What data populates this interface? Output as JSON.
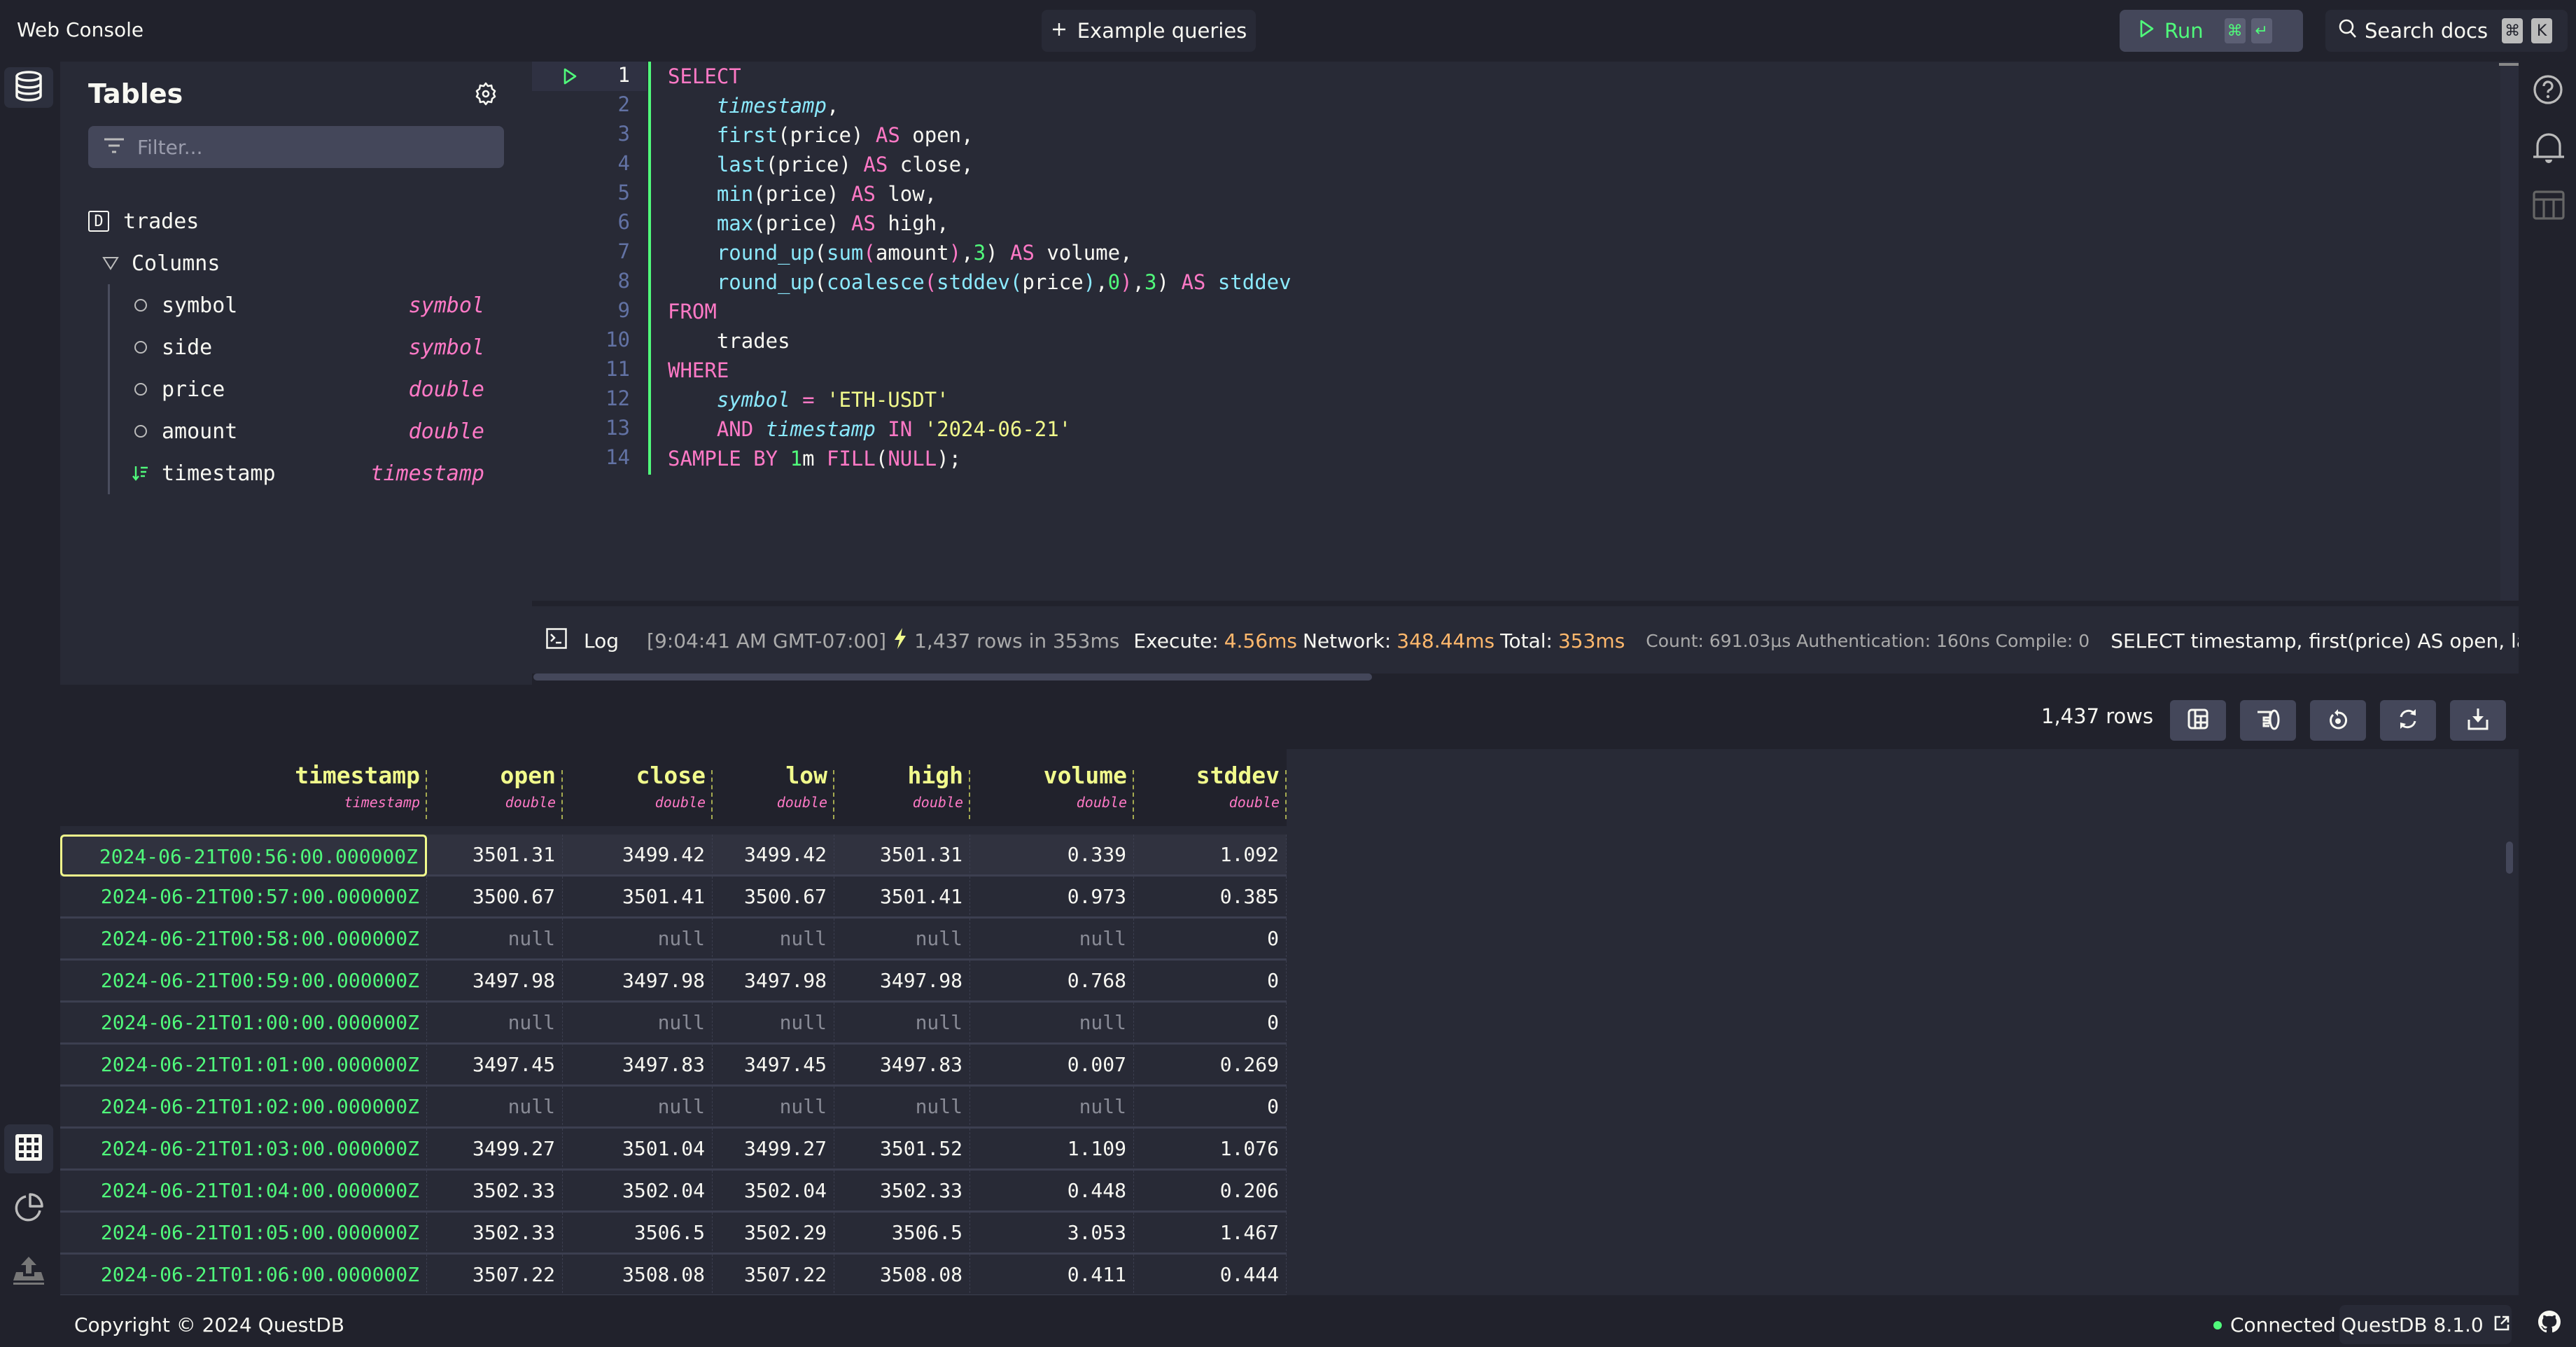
{
  "app": {
    "title": "Web Console"
  },
  "toolbar": {
    "example_queries_label": "Example queries",
    "run_label": "Run",
    "run_shortcut": [
      "⌘",
      "↵"
    ],
    "search_docs_label": "Search docs",
    "search_shortcut": [
      "⌘",
      "K"
    ]
  },
  "tables_panel": {
    "title": "Tables",
    "filter_placeholder": "Filter...",
    "filter_value": "",
    "table": {
      "badge": "D",
      "name": "trades",
      "columns_label": "Columns",
      "columns": [
        {
          "name": "symbol",
          "type": "symbol",
          "designated_timestamp": false
        },
        {
          "name": "side",
          "type": "symbol",
          "designated_timestamp": false
        },
        {
          "name": "price",
          "type": "double",
          "designated_timestamp": false
        },
        {
          "name": "amount",
          "type": "double",
          "designated_timestamp": false
        },
        {
          "name": "timestamp",
          "type": "timestamp",
          "designated_timestamp": true
        }
      ]
    }
  },
  "editor": {
    "current_line": 1,
    "lines": [
      [
        [
          "kw",
          "SELECT"
        ]
      ],
      [
        [
          "id",
          "    "
        ],
        [
          "it",
          "timestamp"
        ],
        [
          "pun",
          ","
        ]
      ],
      [
        [
          "id",
          "    "
        ],
        [
          "fn",
          "first"
        ],
        [
          "pun",
          "("
        ],
        [
          "id",
          "price"
        ],
        [
          "pun",
          ") "
        ],
        [
          "kw",
          "AS"
        ],
        [
          "id",
          " open,"
        ]
      ],
      [
        [
          "id",
          "    "
        ],
        [
          "fn",
          "last"
        ],
        [
          "pun",
          "("
        ],
        [
          "id",
          "price"
        ],
        [
          "pun",
          ") "
        ],
        [
          "kw",
          "AS"
        ],
        [
          "id",
          " close,"
        ]
      ],
      [
        [
          "id",
          "    "
        ],
        [
          "fn",
          "min"
        ],
        [
          "pun",
          "("
        ],
        [
          "id",
          "price"
        ],
        [
          "pun",
          ") "
        ],
        [
          "kw",
          "AS"
        ],
        [
          "id",
          " low,"
        ]
      ],
      [
        [
          "id",
          "    "
        ],
        [
          "fn",
          "max"
        ],
        [
          "pun",
          "("
        ],
        [
          "id",
          "price"
        ],
        [
          "pun",
          ") "
        ],
        [
          "kw",
          "AS"
        ],
        [
          "id",
          " high,"
        ]
      ],
      [
        [
          "id",
          "    "
        ],
        [
          "fn",
          "round_up"
        ],
        [
          "pun",
          "("
        ],
        [
          "fn",
          "sum"
        ],
        [
          "kw",
          "("
        ],
        [
          "id",
          "amount"
        ],
        [
          "kw",
          ")"
        ],
        [
          "pun",
          ","
        ],
        [
          "num",
          "3"
        ],
        [
          "pun",
          ") "
        ],
        [
          "kw",
          "AS"
        ],
        [
          "id",
          " volume,"
        ]
      ],
      [
        [
          "id",
          "    "
        ],
        [
          "fn",
          "round_up"
        ],
        [
          "pun",
          "("
        ],
        [
          "fn",
          "coalesce"
        ],
        [
          "kw",
          "("
        ],
        [
          "fn",
          "stddev"
        ],
        [
          "fn",
          "("
        ],
        [
          "id",
          "price"
        ],
        [
          "fn",
          ")"
        ],
        [
          "pun",
          ","
        ],
        [
          "num",
          "0"
        ],
        [
          "kw",
          ")"
        ],
        [
          "pun",
          ","
        ],
        [
          "num",
          "3"
        ],
        [
          "pun",
          ") "
        ],
        [
          "kw",
          "AS"
        ],
        [
          "fn",
          " stddev"
        ]
      ],
      [
        [
          "kw",
          "FROM"
        ]
      ],
      [
        [
          "id",
          "    trades"
        ]
      ],
      [
        [
          "kw",
          "WHERE"
        ]
      ],
      [
        [
          "id",
          "    "
        ],
        [
          "it",
          "symbol"
        ],
        [
          "kw",
          " = "
        ],
        [
          "str",
          "'ETH-USDT'"
        ]
      ],
      [
        [
          "id",
          "    "
        ],
        [
          "kw",
          "AND "
        ],
        [
          "it",
          "timestamp"
        ],
        [
          "kw",
          " IN "
        ],
        [
          "str",
          "'2024-06-21'"
        ]
      ],
      [
        [
          "kw",
          "SAMPLE BY "
        ],
        [
          "num",
          "1"
        ],
        [
          "id",
          "m "
        ],
        [
          "kw",
          "FILL"
        ],
        [
          "pun",
          "("
        ],
        [
          "kw",
          "NULL"
        ],
        [
          "pun",
          ");"
        ]
      ]
    ]
  },
  "log": {
    "label": "Log",
    "timestamp": "[9:04:41 AM GMT-07:00]",
    "summary": "1,437 rows in 353ms",
    "execute_label": "Execute:",
    "execute_value": "4.56ms",
    "network_label": "Network:",
    "network_value": "348.44ms",
    "total_label": "Total:",
    "total_value": "353ms",
    "details": "Count: 691.03µs Authentication: 160ns Compile: 0",
    "query_preview": "SELECT timestamp, first(price) AS open, last(price) AS close, min(price) AS low, max(price) AS high"
  },
  "grid": {
    "row_count_label": "1,437 rows",
    "toolbar_buttons": [
      "freeze-columns",
      "shrink-columns",
      "reset-layout",
      "refresh",
      "download-csv"
    ],
    "columns": [
      {
        "name": "timestamp",
        "type": "timestamp"
      },
      {
        "name": "open",
        "type": "double"
      },
      {
        "name": "close",
        "type": "double"
      },
      {
        "name": "low",
        "type": "double"
      },
      {
        "name": "high",
        "type": "double"
      },
      {
        "name": "volume",
        "type": "double"
      },
      {
        "name": "stddev",
        "type": "double"
      }
    ],
    "rows": [
      [
        "2024-06-21T00:56:00.000000Z",
        "3501.31",
        "3499.42",
        "3499.42",
        "3501.31",
        "0.339",
        "1.092"
      ],
      [
        "2024-06-21T00:57:00.000000Z",
        "3500.67",
        "3501.41",
        "3500.67",
        "3501.41",
        "0.973",
        "0.385"
      ],
      [
        "2024-06-21T00:58:00.000000Z",
        "null",
        "null",
        "null",
        "null",
        "null",
        "0"
      ],
      [
        "2024-06-21T00:59:00.000000Z",
        "3497.98",
        "3497.98",
        "3497.98",
        "3497.98",
        "0.768",
        "0"
      ],
      [
        "2024-06-21T01:00:00.000000Z",
        "null",
        "null",
        "null",
        "null",
        "null",
        "0"
      ],
      [
        "2024-06-21T01:01:00.000000Z",
        "3497.45",
        "3497.83",
        "3497.45",
        "3497.83",
        "0.007",
        "0.269"
      ],
      [
        "2024-06-21T01:02:00.000000Z",
        "null",
        "null",
        "null",
        "null",
        "null",
        "0"
      ],
      [
        "2024-06-21T01:03:00.000000Z",
        "3499.27",
        "3501.04",
        "3499.27",
        "3501.52",
        "1.109",
        "1.076"
      ],
      [
        "2024-06-21T01:04:00.000000Z",
        "3502.33",
        "3502.04",
        "3502.04",
        "3502.33",
        "0.448",
        "0.206"
      ],
      [
        "2024-06-21T01:05:00.000000Z",
        "3502.33",
        "3506.5",
        "3502.29",
        "3506.5",
        "3.053",
        "1.467"
      ],
      [
        "2024-06-21T01:06:00.000000Z",
        "3507.22",
        "3508.08",
        "3507.22",
        "3508.08",
        "0.411",
        "0.444"
      ]
    ],
    "selected_row": 0
  },
  "footer": {
    "copyright": "Copyright © 2024 QuestDB",
    "status": "Connected",
    "version": "QuestDB 8.1.0"
  },
  "colors": {
    "background": "#21222c",
    "panel": "#282a36",
    "accent_green": "#50fa7b",
    "keyword_pink": "#ff79c6",
    "header_yellow": "#f1fa8c",
    "function_cyan": "#8be9fd",
    "timing_orange": "#ffb86c"
  }
}
